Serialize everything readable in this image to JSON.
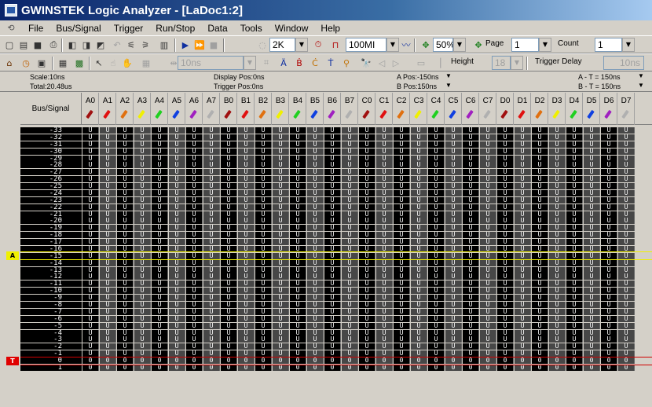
{
  "window": {
    "title": "GWINSTEK Logic Analyzer - [LaDoc1:2]"
  },
  "menu": [
    "File",
    "Bus/Signal",
    "Trigger",
    "Run/Stop",
    "Data",
    "Tools",
    "Window",
    "Help"
  ],
  "toolbar1": {
    "depth": "2K",
    "rate": "100MI",
    "zoom": "50%",
    "page_label": "Page",
    "page_value": "1",
    "count_label": "Count",
    "count_value": "1"
  },
  "toolbar2": {
    "interval": "10ns",
    "height_label": "Height",
    "height_value": "18",
    "trigger_delay_label": "Trigger Delay",
    "trigger_delay_value": "10ns"
  },
  "info": {
    "scale": "Scale:10ns",
    "total": "Total:20.48us",
    "display_pos": "Display Pos:0ns",
    "trigger_pos": "Trigger Pos:0ns",
    "a_pos": "A Pos:-150ns",
    "b_pos": "B Pos:150ns",
    "a_minus_t": "A - T = 150ns",
    "b_minus_t": "B - T = 150ns"
  },
  "markers": {
    "a": "A",
    "t": "T"
  },
  "columns": {
    "bus_signal": "Bus/Signal"
  },
  "channels": [
    {
      "name": "A0",
      "color": "#a01010"
    },
    {
      "name": "A1",
      "color": "#e01010"
    },
    {
      "name": "A2",
      "color": "#e07010"
    },
    {
      "name": "A3",
      "color": "#f0f000"
    },
    {
      "name": "A4",
      "color": "#20d020"
    },
    {
      "name": "A5",
      "color": "#1040e0"
    },
    {
      "name": "A6",
      "color": "#a020c0"
    },
    {
      "name": "A7",
      "color": "#b0b0b0"
    },
    {
      "name": "B0",
      "color": "#a01010"
    },
    {
      "name": "B1",
      "color": "#e01010"
    },
    {
      "name": "B2",
      "color": "#e07010"
    },
    {
      "name": "B3",
      "color": "#f0f000"
    },
    {
      "name": "B4",
      "color": "#20d020"
    },
    {
      "name": "B5",
      "color": "#1040e0"
    },
    {
      "name": "B6",
      "color": "#a020c0"
    },
    {
      "name": "B7",
      "color": "#b0b0b0"
    },
    {
      "name": "C0",
      "color": "#a01010"
    },
    {
      "name": "C1",
      "color": "#e01010"
    },
    {
      "name": "C2",
      "color": "#e07010"
    },
    {
      "name": "C3",
      "color": "#f0f000"
    },
    {
      "name": "C4",
      "color": "#20d020"
    },
    {
      "name": "C5",
      "color": "#1040e0"
    },
    {
      "name": "C6",
      "color": "#a020c0"
    },
    {
      "name": "C7",
      "color": "#b0b0b0"
    },
    {
      "name": "D0",
      "color": "#a01010"
    },
    {
      "name": "D1",
      "color": "#e01010"
    },
    {
      "name": "D2",
      "color": "#e07010"
    },
    {
      "name": "D3",
      "color": "#f0f000"
    },
    {
      "name": "D4",
      "color": "#20d020"
    },
    {
      "name": "D5",
      "color": "#1040e0"
    },
    {
      "name": "D6",
      "color": "#a020c0"
    },
    {
      "name": "D7",
      "color": "#b0b0b0"
    }
  ],
  "rows": [
    "-33",
    "-32",
    "-31",
    "-30",
    "-29",
    "-28",
    "-27",
    "-26",
    "-25",
    "-24",
    "-23",
    "-22",
    "-21",
    "-20",
    "-19",
    "-18",
    "-17",
    "-16",
    "-15",
    "-14",
    "-13",
    "-12",
    "-11",
    "-10",
    "-9",
    "-8",
    "-7",
    "-6",
    "-5",
    "-4",
    "-3",
    "-2",
    "-1",
    "0",
    "1"
  ],
  "cell_values": {
    "before_trigger": "U",
    "from_trigger": "0"
  },
  "highlighted_row": "-15",
  "trigger_row": "0",
  "icons": {
    "toolbar1": [
      "new-file-icon",
      "open-folder-icon",
      "save-icon",
      "print-icon",
      "capture-icon",
      "capture-multi-icon",
      "capture-repeat-icon",
      "undo-icon",
      "pattern-icon",
      "pattern2-icon",
      "measure-icon",
      "run-icon",
      "run-repeat-icon",
      "stop-icon",
      "depth-icon",
      "clock-icon",
      "rate-icon",
      "zoom-icon",
      "page-icon"
    ],
    "toolbar2": [
      "home-icon",
      "timing-icon",
      "state-icon",
      "list-icon",
      "table-icon",
      "pointer-icon",
      "hand-icon",
      "grab-icon",
      "grid-icon",
      "interval-icon",
      "bus-a-icon",
      "bus-b-icon",
      "bus-c-icon",
      "bus-d-icon",
      "bus-t-icon",
      "find-icon",
      "prev-icon",
      "next-icon",
      "screen-icon",
      "height-icon"
    ]
  }
}
